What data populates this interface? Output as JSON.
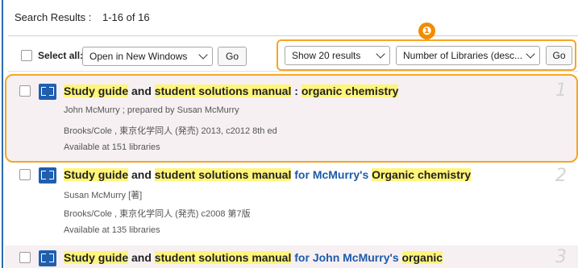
{
  "header": {
    "label": "Search Results :",
    "range": "1-16",
    "of_word": "of",
    "total": "16"
  },
  "toolbar": {
    "select_all_label": "Select all:",
    "open_mode": "Open in New Windows",
    "go_label": "Go",
    "page_size": "Show 20 results",
    "sort_by": "Number of Libraries (desc...",
    "sort_go_label": "Go",
    "callout_number": "❶",
    "highlight_color": "#f5a623"
  },
  "results": [
    {
      "rank": "1",
      "title_parts": [
        {
          "text": "Study guide",
          "style": "hl"
        },
        {
          "text": " and ",
          "style": "plain"
        },
        {
          "text": "student solutions manual",
          "style": "hl"
        },
        {
          "text": " : ",
          "style": "plain"
        },
        {
          "text": "organic chemistry",
          "style": "hl"
        }
      ],
      "author": "John McMurry ; prepared by Susan McMurry",
      "publisher": "Brooks/Cole , 東京化学同人 (発売) 2013, c2012 8th ed",
      "availability": "Available at 151 libraries"
    },
    {
      "rank": "2",
      "title_parts": [
        {
          "text": "Study guide",
          "style": "hl"
        },
        {
          "text": " and ",
          "style": "plain"
        },
        {
          "text": "student solutions manual",
          "style": "hl"
        },
        {
          "text": " for McMurry's ",
          "style": "blue"
        },
        {
          "text": "Organic chemistry",
          "style": "hl"
        }
      ],
      "author": "Susan McMurry [著]",
      "publisher": "Brooks/Cole , 東京化学同人 (発売) c2008 第7版",
      "availability": "Available at 135 libraries"
    },
    {
      "rank": "3",
      "title_parts": [
        {
          "text": "Study guide",
          "style": "hl"
        },
        {
          "text": " and ",
          "style": "plain"
        },
        {
          "text": "student solutions manual",
          "style": "hl"
        },
        {
          "text": " for John McMurry's ",
          "style": "blue"
        },
        {
          "text": "organic",
          "style": "hl"
        }
      ]
    }
  ]
}
